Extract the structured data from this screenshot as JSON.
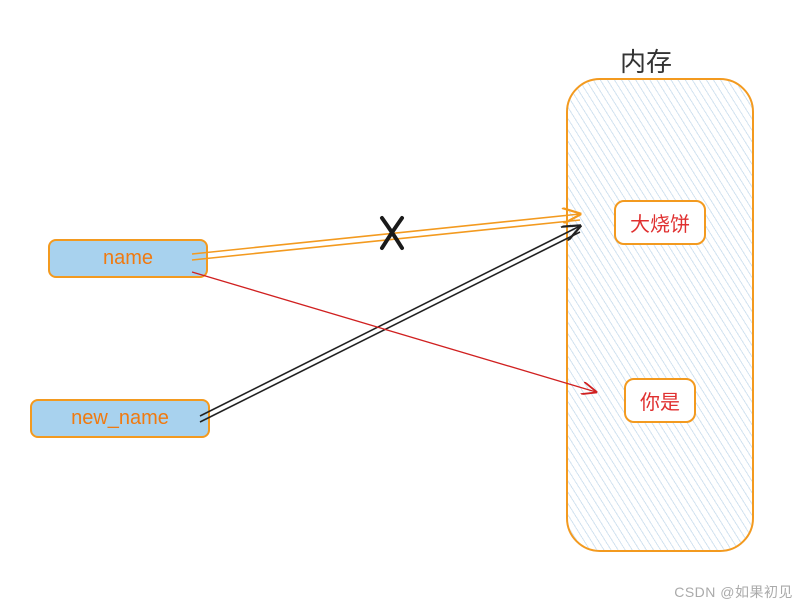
{
  "diagram": {
    "memory_label": "内存",
    "variables": {
      "name": "name",
      "new_name": "new_name"
    },
    "cells": {
      "value1": "大烧饼",
      "value2": "你是"
    },
    "cross_mark": "X",
    "arrows": [
      {
        "from": "name",
        "to": "value1",
        "color": "#f39a1f",
        "crossed": true
      },
      {
        "from": "name",
        "to": "value2",
        "color": "#d02020",
        "crossed": false
      },
      {
        "from": "new_name",
        "to": "value1",
        "color": "#222222",
        "crossed": false
      }
    ],
    "watermark": "CSDN @如果初见"
  },
  "colors": {
    "orange": "#f39a1f",
    "red_text": "#e03030",
    "blue_fill": "#a8d2ee",
    "arrow_red": "#d02020",
    "arrow_black": "#222222"
  }
}
